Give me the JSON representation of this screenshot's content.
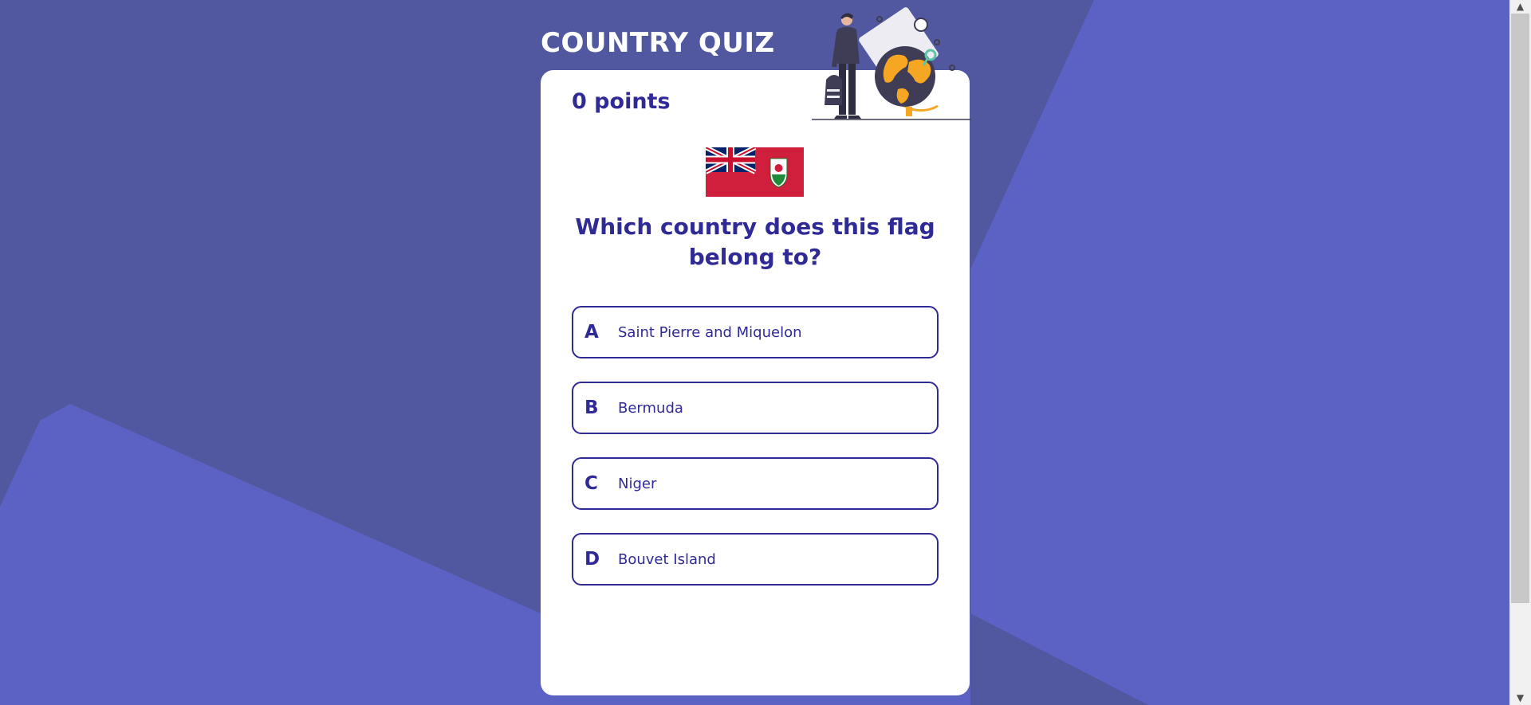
{
  "quiz": {
    "title": "COUNTRY QUIZ",
    "score_label": "0 points",
    "question": "Which country does this flag belong to?",
    "flag_icon": "bermuda-flag-icon",
    "options": [
      {
        "letter": "A",
        "text": "Saint Pierre and Miquelon"
      },
      {
        "letter": "B",
        "text": "Bermuda"
      },
      {
        "letter": "C",
        "text": "Niger"
      },
      {
        "letter": "D",
        "text": "Bouvet Island"
      }
    ]
  },
  "colors": {
    "background": "#5b62c4",
    "background_shade": "#5158a0",
    "accent": "#2f2a96",
    "card": "#ffffff",
    "globe": "#f5a623",
    "flag_red": "#cf1f3c"
  },
  "icons": {
    "illustration": "traveler-with-globe-icon",
    "scroll_up": "chevron-up-icon",
    "scroll_down": "chevron-down-icon"
  }
}
